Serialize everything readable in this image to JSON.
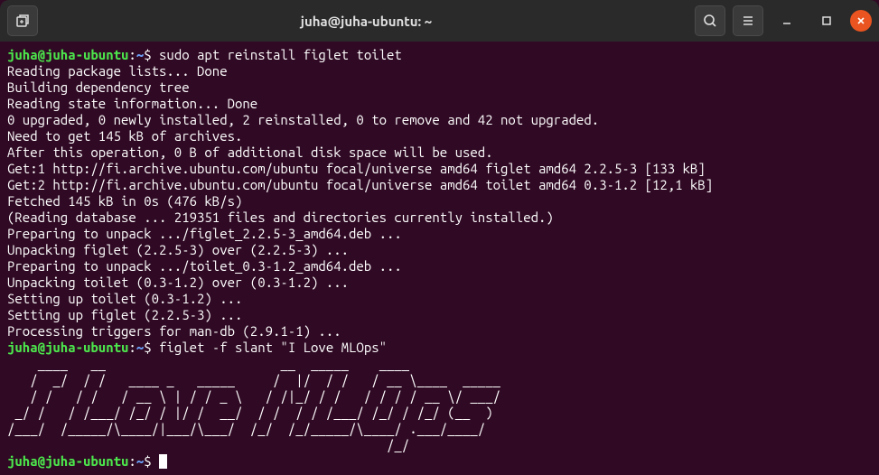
{
  "titlebar": {
    "title": "juha@juha-ubuntu: ~"
  },
  "terminal": {
    "prompt": {
      "user_host": "juha@juha-ubuntu",
      "colon": ":",
      "path": "~",
      "dollar": "$"
    },
    "command1": " sudo apt reinstall figlet toilet",
    "output1": "Reading package lists... Done\nBuilding dependency tree\nReading state information... Done\n0 upgraded, 0 newly installed, 2 reinstalled, 0 to remove and 42 not upgraded.\nNeed to get 145 kB of archives.\nAfter this operation, 0 B of additional disk space will be used.\nGet:1 http://fi.archive.ubuntu.com/ubuntu focal/universe amd64 figlet amd64 2.2.5-3 [133 kB]\nGet:2 http://fi.archive.ubuntu.com/ubuntu focal/universe amd64 toilet amd64 0.3-1.2 [12,1 kB]\nFetched 145 kB in 0s (476 kB/s)\n(Reading database ... 219351 files and directories currently installed.)\nPreparing to unpack .../figlet_2.2.5-3_amd64.deb ...\nUnpacking figlet (2.2.5-3) over (2.2.5-3) ...\nPreparing to unpack .../toilet_0.3-1.2_amd64.deb ...\nUnpacking toilet (0.3-1.2) over (0.3-1.2) ...\nSetting up toilet (0.3-1.2) ...\nSetting up figlet (2.2.5-3) ...\nProcessing triggers for man-db (2.9.1-1) ...",
    "command2": " figlet -f slant \"I Love MLOps\"",
    "output2": "    ____   __                       __  _____    ____            \n   /  _/  / /   ____ _   _____     /  |/  / /   / __ \\____  _____\n   / /   / /   / __ \\ | / / _ \\   / /|_/ / /   / / / / __ \\/ ___/\n _/ /   / /___/ /_/ / |/ /  __/  / /  / / /___/ /_/ / /_/ (__  ) \n/___/  /_____/\\____/|___/\\___/  /_/  /_/_____/\\____/ .___/____/  \n                                                  /_/            ",
    "command3": " "
  }
}
